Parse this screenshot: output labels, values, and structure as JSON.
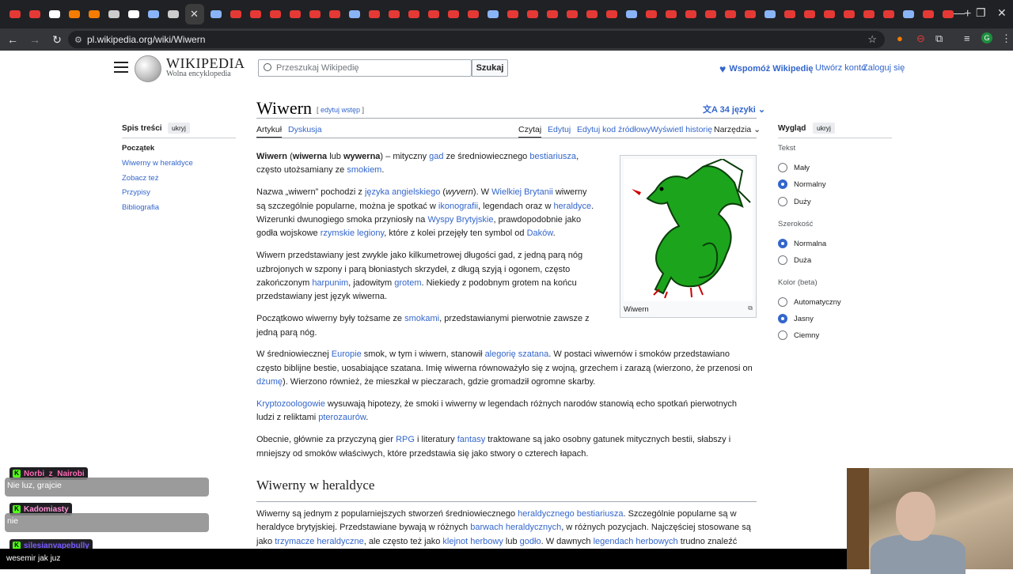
{
  "browser": {
    "url": "pl.wikipedia.org/wiki/Wiwern",
    "tab_count_icons": 48
  },
  "header": {
    "logo_word": "WIKIPEDIA",
    "logo_tagline": "Wolna encyklopedia",
    "search_placeholder": "Przeszukaj Wikipedię",
    "search_button": "Szukaj",
    "donate": "Wspomóż Wikipedię",
    "create_account": "Utwórz konto",
    "login": "Zaloguj się"
  },
  "article": {
    "title": "Wiwern",
    "edit_intro": "edytuj wstęp",
    "languages": "34 języki",
    "tabs": {
      "article": "Artykuł",
      "discussion": "Dyskusja",
      "read": "Czytaj",
      "edit": "Edytuj",
      "edit_source": "Edytuj kod źródłowy",
      "history": "Wyświetl historię",
      "tools": "Narzędzia"
    },
    "image_caption": "Wiwern",
    "section2_title": "Wiwerny w heraldyce"
  },
  "toc": {
    "title": "Spis treści",
    "hide": "ukryj",
    "items": [
      "Początek",
      "Wiwerny w heraldyce",
      "Zobacz też",
      "Przypisy",
      "Bibliografia"
    ]
  },
  "appearance": {
    "title": "Wygląd",
    "hide": "ukryj",
    "text_label": "Tekst",
    "text_options": [
      "Mały",
      "Normalny",
      "Duży"
    ],
    "width_label": "Szerokość",
    "width_options": [
      "Normalna",
      "Duża"
    ],
    "color_label": "Kolor (beta)",
    "color_options": [
      "Automatyczny",
      "Jasny",
      "Ciemny"
    ]
  },
  "chat": {
    "users": [
      "Norbi_z_Nairobi",
      "Kadomiasty",
      "silesianvapebully"
    ],
    "messages": [
      "Nie luz, grajcie",
      "nie"
    ],
    "bottom_message": "wesemir jak juz"
  }
}
